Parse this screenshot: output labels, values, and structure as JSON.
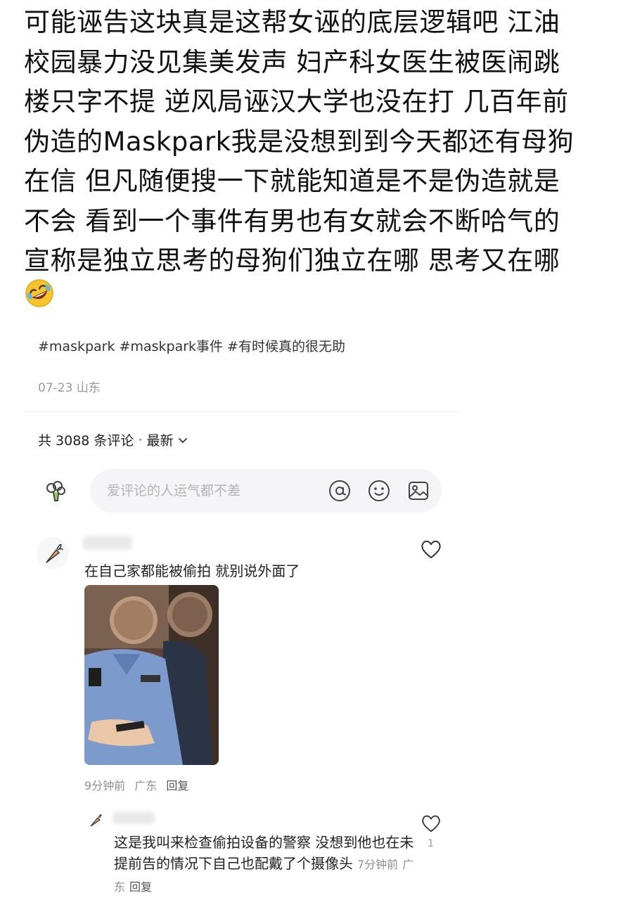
{
  "post": {
    "lines": [
      "可能诬告这块真是这帮女诬的底层逻辑吧 江油",
      "校园暴力没见集美发声 妇产科女医生被医闹跳",
      "楼只字不提 逆风局诬汉大学也没在打 几百年前",
      "伪造的Maskpark我是没想到到今天都还有母狗",
      "在信 但凡随便搜一下就能知道是不是伪造就是",
      "不会 看到一个事件有男也有女就会不断哈气的",
      "宣称是独立思考的母狗们独立在哪 思考又在哪"
    ],
    "emoji": "rolling-on-floor-laughing-icon"
  },
  "source_post": {
    "hashtags": "#maskpark #maskpark事件 #有时候真的很无助",
    "date": "07-23",
    "location": "山东"
  },
  "comments_section": {
    "count_label": "共 3088 条评论",
    "sort_label": "最新",
    "input_placeholder": "爱评论的人运气都不差"
  },
  "comments": [
    {
      "text": "在自己家都能被偷拍 就别说外面了",
      "time": "9分钟前",
      "location": "广东",
      "reply_label": "回复",
      "likes": ""
    },
    {
      "text": "这是我叫来检查偷拍设备的警察 没想到他也在未提前告的情况下自己也配戴了个摄像头",
      "time": "7分钟前",
      "location": "广东",
      "reply_label": "回复",
      "likes": "1"
    }
  ],
  "colors": {
    "text": "#111111",
    "meta": "#9a9a9a",
    "input_bg": "#f5f5f7"
  }
}
